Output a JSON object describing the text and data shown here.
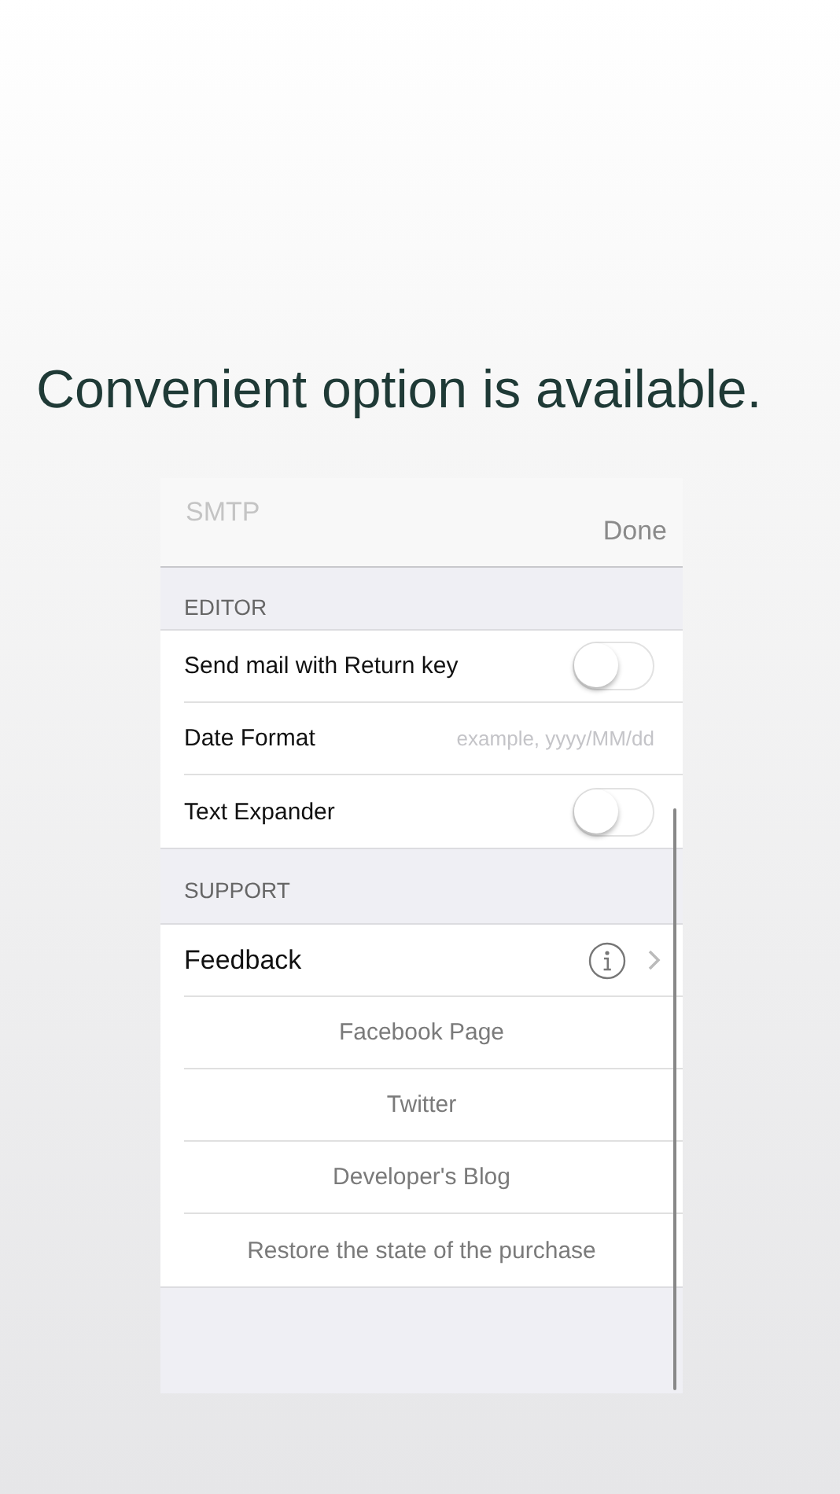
{
  "headline": "Convenient option is available.",
  "nav": {
    "back_title": "SMTP",
    "done": "Done"
  },
  "sections": [
    {
      "header": "EDITOR",
      "rows": [
        {
          "kind": "toggle",
          "label": "Send mail with Return key",
          "on": false
        },
        {
          "kind": "field",
          "label": "Date Format",
          "placeholder": "example, yyyy/MM/dd"
        },
        {
          "kind": "toggle",
          "label": "Text Expander",
          "on": false
        }
      ]
    },
    {
      "header": "SUPPORT",
      "rows": [
        {
          "kind": "disclosure",
          "label": "Feedback"
        },
        {
          "kind": "link",
          "label": "Facebook Page"
        },
        {
          "kind": "link",
          "label": "Twitter"
        },
        {
          "kind": "link",
          "label": "Developer's Blog"
        },
        {
          "kind": "link",
          "label": "Restore the state of the purchase"
        }
      ]
    }
  ]
}
